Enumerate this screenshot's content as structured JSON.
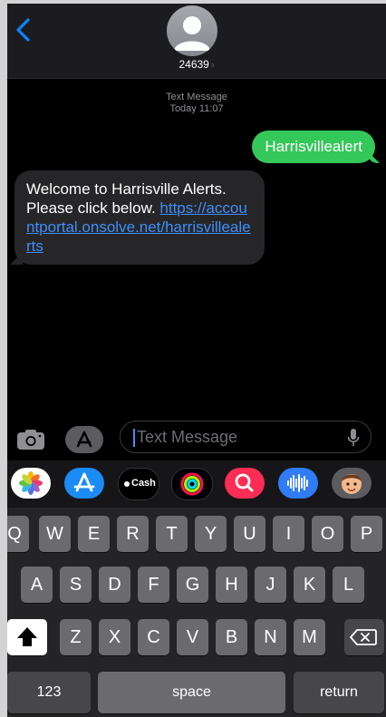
{
  "header": {
    "contact_name": "24639",
    "chevron": "›",
    "back_icon": "chevron-left-icon",
    "avatar_icon": "person-icon"
  },
  "thread": {
    "service_label": "Text Message",
    "timestamp": "Today 11:07",
    "messages": [
      {
        "direction": "outgoing",
        "text": "Harrisvillealert"
      },
      {
        "direction": "incoming",
        "text_before_link": "Welcome to Harrisville Alerts. Please click below. ",
        "link_text": "https://accountportal.onsolve.net/harrisvillealerts"
      }
    ]
  },
  "composer": {
    "placeholder": "Text Message",
    "camera_icon": "camera-icon",
    "apps_icon": "app-store-icon",
    "mic_icon": "microphone-icon"
  },
  "app_tray": {
    "apps": [
      {
        "name": "photos",
        "icon": "photos-icon"
      },
      {
        "name": "app-store",
        "icon": "app-store-icon"
      },
      {
        "name": "apple-cash",
        "label": "Cash",
        "icon": "apple-cash-icon"
      },
      {
        "name": "fitness",
        "icon": "activity-rings-icon"
      },
      {
        "name": "images-search",
        "icon": "image-search-icon"
      },
      {
        "name": "audio",
        "icon": "waveform-icon"
      },
      {
        "name": "memoji",
        "icon": "memoji-icon"
      }
    ]
  },
  "keyboard": {
    "row1": [
      "Q",
      "W",
      "E",
      "R",
      "T",
      "Y",
      "U",
      "I",
      "O",
      "P"
    ],
    "row2": [
      "A",
      "S",
      "D",
      "F",
      "G",
      "H",
      "J",
      "K",
      "L"
    ],
    "row3": [
      "Z",
      "X",
      "C",
      "V",
      "B",
      "N",
      "M"
    ],
    "numbers_label": "123",
    "space_label": "space",
    "return_label": "return",
    "shift_icon": "shift-icon",
    "delete_icon": "delete-backspace-icon"
  },
  "colors": {
    "outgoing_bubble": "#34c759",
    "incoming_bubble": "#262628",
    "link": "#3f8efc",
    "accent": "#0a84ff"
  }
}
